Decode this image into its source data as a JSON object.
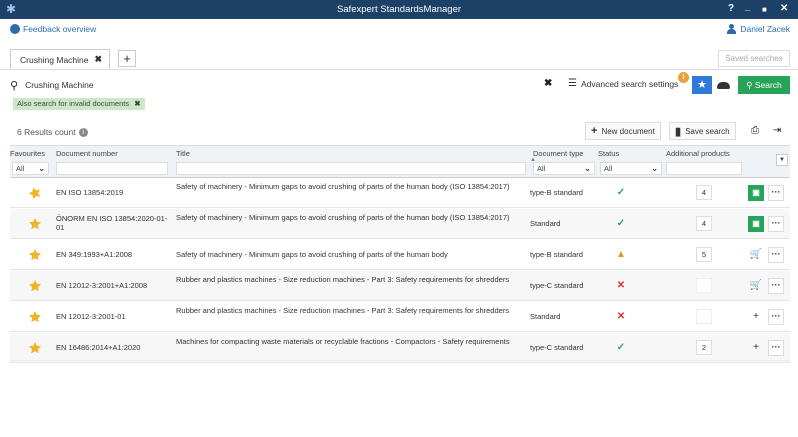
{
  "window": {
    "title": "Safexpert StandardsManager",
    "help_symbol": "?",
    "minimize_symbol": "_",
    "maximize_symbol": "■",
    "close_symbol": "✕"
  },
  "topbar": {
    "feedback_label": "Feedback overview",
    "user_name": "Daniel Zacek"
  },
  "tabs": {
    "items": [
      {
        "label": "Crushing Machine",
        "close": "✖"
      }
    ],
    "add_symbol": "+",
    "saved_searches_label": "Saved searches"
  },
  "search": {
    "value": "Crushing Machine",
    "placeholder": "",
    "clear_symbol": "✖",
    "advanced_label": "Advanced search settings",
    "advanced_badge": "!",
    "search_button_label": "Search",
    "filter_chip": "Also search for invalid documents",
    "filter_chip_close": "✖"
  },
  "results": {
    "count_label": "6 Results count",
    "info_symbol": "i",
    "new_document_label": "New document",
    "save_search_label": "Save search",
    "new_document_symbol": "+"
  },
  "table": {
    "headers": {
      "favourites": "Favourites",
      "document_number": "Document number",
      "title": "Title",
      "document_type": "Document type",
      "status": "Status",
      "additional_products": "Additional products"
    },
    "filters": {
      "favourites": "All",
      "document_type": "All",
      "status": "All"
    },
    "rows": [
      {
        "number": "EN ISO 13854:2019",
        "title": "Safety of machinery - Minimum gaps to avoid crushing of parts of the human body (ISO 13854:2017)",
        "type": "type-B standard",
        "status": "valid",
        "status_symbol": "✓",
        "products": "4",
        "action": "document",
        "action_symbol": "▣",
        "favourite": "star-partial"
      },
      {
        "number": "ÖNORM EN ISO 13854:2020-01-01",
        "title": "Safety of machinery - Minimum gaps to avoid crushing of parts of the human body (ISO 13854:2017)",
        "type": "Standard",
        "status": "valid",
        "status_symbol": "✓",
        "products": "4",
        "action": "document",
        "action_symbol": "▣",
        "favourite": "star-full"
      },
      {
        "number": "EN 349:1993+A1:2008",
        "title": "Safety of machinery - Minimum gaps to avoid crushing of parts of the human body",
        "type": "type-B standard",
        "status": "warning",
        "status_symbol": "▲",
        "products": "5",
        "action": "cart",
        "action_symbol": "🛒",
        "favourite": "star-full"
      },
      {
        "number": "EN 12012-3:2001+A1:2008",
        "title": "Rubber and plastics machines - Size reduction machines - Part 3: Safety requirements for shredders",
        "type": "type-C standard",
        "status": "invalid",
        "status_symbol": "✕",
        "products": "",
        "action": "cart",
        "action_symbol": "🛒",
        "favourite": "star-full"
      },
      {
        "number": "EN 12012-3:2001-01",
        "title": "Rubber and plastics machines - Size reduction machines - Part 3: Safety requirements for shredders",
        "type": "Standard",
        "status": "invalid",
        "status_symbol": "✕",
        "products": "",
        "action": "add",
        "action_symbol": "+",
        "favourite": "star-full"
      },
      {
        "number": "EN 16486:2014+A1:2020",
        "title": "Machines for compacting waste materials or recyclable fractions - Compactors - Safety requirements",
        "type": "type-C standard",
        "status": "valid",
        "status_symbol": "✓",
        "products": "2",
        "action": "add",
        "action_symbol": "+",
        "favourite": "star-full"
      }
    ],
    "more_symbol": "···"
  },
  "colors": {
    "titlebar": "#1c4066",
    "accent_blue": "#2f7ad8",
    "search_green": "#27a35a",
    "star_gold": "#f0b429",
    "valid_green": "#2ea84f",
    "warning_orange": "#e8902a",
    "invalid_red": "#d93030"
  }
}
